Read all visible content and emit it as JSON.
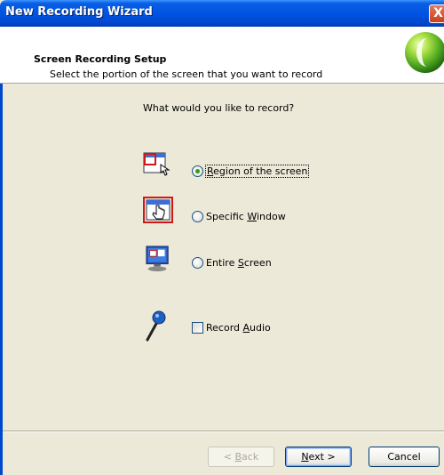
{
  "window": {
    "title": "New Recording Wizard",
    "close_symbol": "X"
  },
  "header": {
    "title": "Screen Recording Setup",
    "subtitle": "Select the portion of the screen that you want to record"
  },
  "question": "What would you like to record?",
  "options": [
    {
      "pre": "",
      "accel": "R",
      "post": "egion of the screen",
      "selected": true,
      "focused": true,
      "icon": "region-icon"
    },
    {
      "pre": "Specific ",
      "accel": "W",
      "post": "indow",
      "selected": false,
      "icon": "window-icon"
    },
    {
      "pre": "Entire ",
      "accel": "S",
      "post": "creen",
      "selected": false,
      "icon": "monitor-icon"
    }
  ],
  "audio": {
    "pre": "Record ",
    "accel": "A",
    "post": "udio",
    "checked": false,
    "icon": "microphone-icon"
  },
  "buttons": {
    "back": {
      "pre": "< ",
      "accel": "B",
      "post": "ack",
      "enabled": false
    },
    "next": {
      "pre": "",
      "accel": "N",
      "post": "ext >",
      "enabled": true
    },
    "cancel": {
      "label": "Cancel"
    }
  },
  "colors": {
    "titlebar": "#0054e3",
    "dialog_bg": "#ece9d8",
    "selected_radio": "#21a121"
  }
}
